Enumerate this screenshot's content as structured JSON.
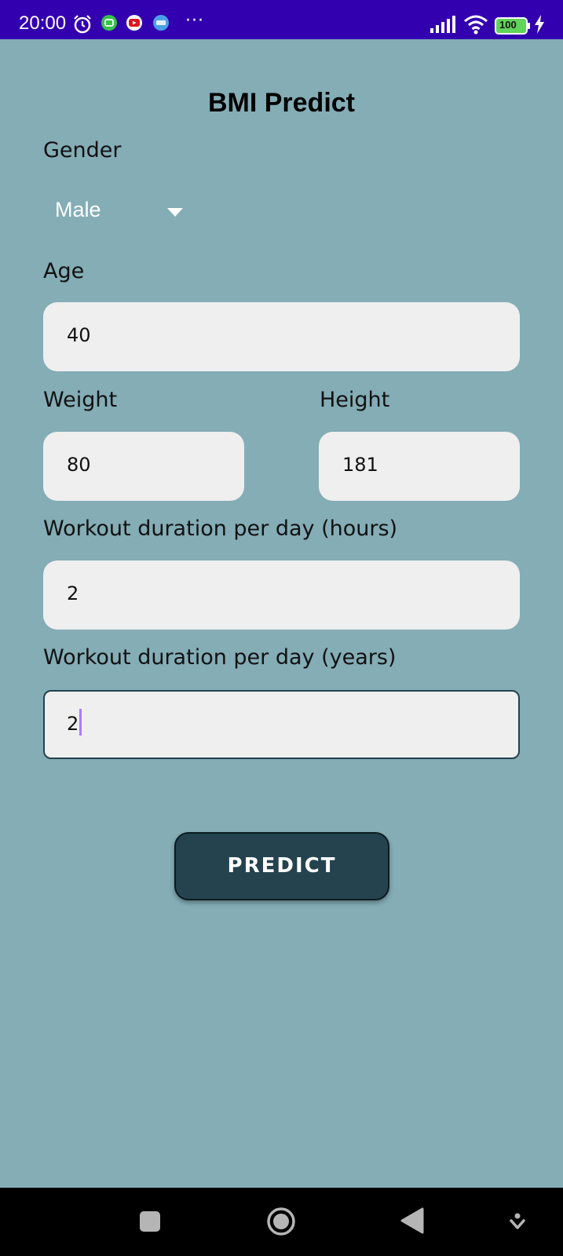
{
  "status_bar": {
    "time": "20:00",
    "more": "···",
    "battery": "100",
    "background": "#3300b0"
  },
  "title": "BMI Predict",
  "form": {
    "gender_label": "Gender",
    "gender_value": "Male",
    "age_label": "Age",
    "age_value": "40",
    "weight_label": "Weight",
    "weight_value": "80",
    "height_label": "Height",
    "height_value": "181",
    "hours_label": "Workout duration per day (hours)",
    "hours_value": "2",
    "years_label": "Workout duration per day (years)",
    "years_value": "2"
  },
  "predict_button": "PREDICT",
  "icons": {
    "status": [
      "alarm-icon",
      "app-notification-icon",
      "youtube-icon",
      "noveltoon-icon",
      "signal-icon",
      "wifi-icon",
      "battery-icon",
      "charging-icon"
    ],
    "nav": [
      "recents-icon",
      "home-icon",
      "back-icon",
      "nav-extra-icon"
    ]
  },
  "colors": {
    "background": "#84adb6",
    "field": "#efefef",
    "button": "#24434f",
    "cursor": "#a77bff"
  }
}
